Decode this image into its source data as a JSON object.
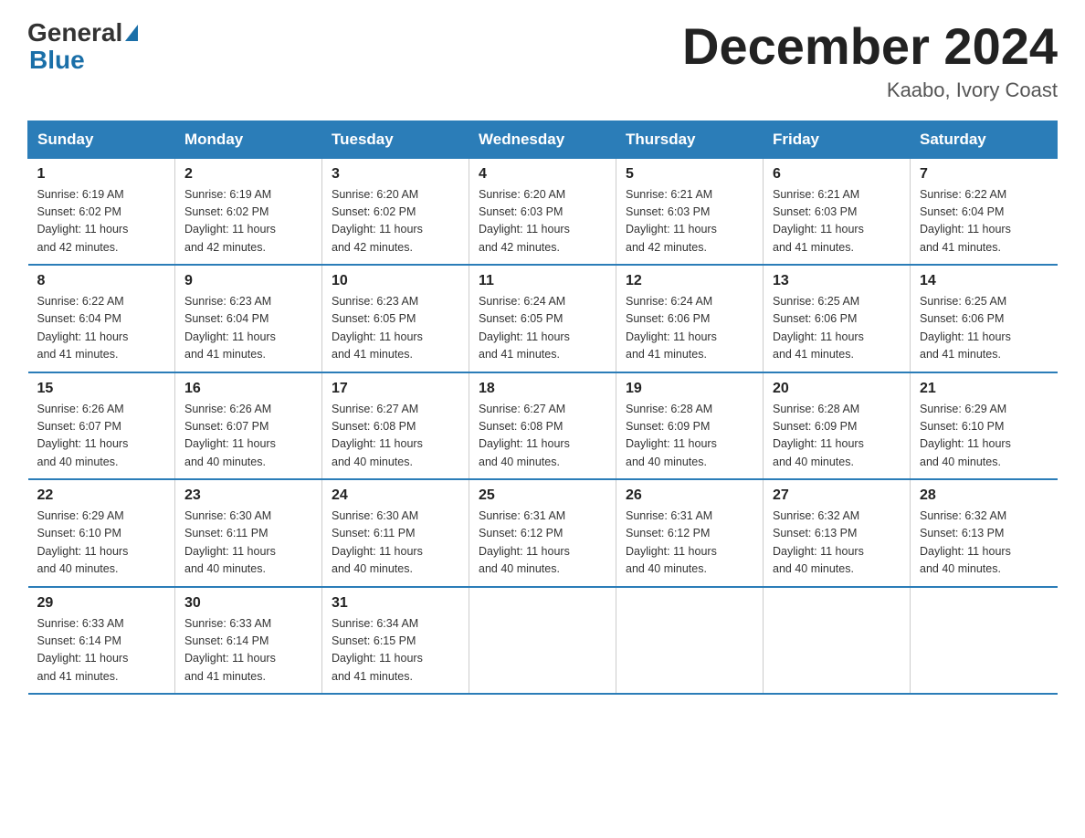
{
  "header": {
    "logo_general": "General",
    "logo_blue": "Blue",
    "month_title": "December 2024",
    "location": "Kaabo, Ivory Coast"
  },
  "days_of_week": [
    "Sunday",
    "Monday",
    "Tuesday",
    "Wednesday",
    "Thursday",
    "Friday",
    "Saturday"
  ],
  "weeks": [
    [
      {
        "day": "1",
        "sunrise": "6:19 AM",
        "sunset": "6:02 PM",
        "daylight": "11 hours and 42 minutes."
      },
      {
        "day": "2",
        "sunrise": "6:19 AM",
        "sunset": "6:02 PM",
        "daylight": "11 hours and 42 minutes."
      },
      {
        "day": "3",
        "sunrise": "6:20 AM",
        "sunset": "6:02 PM",
        "daylight": "11 hours and 42 minutes."
      },
      {
        "day": "4",
        "sunrise": "6:20 AM",
        "sunset": "6:03 PM",
        "daylight": "11 hours and 42 minutes."
      },
      {
        "day": "5",
        "sunrise": "6:21 AM",
        "sunset": "6:03 PM",
        "daylight": "11 hours and 42 minutes."
      },
      {
        "day": "6",
        "sunrise": "6:21 AM",
        "sunset": "6:03 PM",
        "daylight": "11 hours and 41 minutes."
      },
      {
        "day": "7",
        "sunrise": "6:22 AM",
        "sunset": "6:04 PM",
        "daylight": "11 hours and 41 minutes."
      }
    ],
    [
      {
        "day": "8",
        "sunrise": "6:22 AM",
        "sunset": "6:04 PM",
        "daylight": "11 hours and 41 minutes."
      },
      {
        "day": "9",
        "sunrise": "6:23 AM",
        "sunset": "6:04 PM",
        "daylight": "11 hours and 41 minutes."
      },
      {
        "day": "10",
        "sunrise": "6:23 AM",
        "sunset": "6:05 PM",
        "daylight": "11 hours and 41 minutes."
      },
      {
        "day": "11",
        "sunrise": "6:24 AM",
        "sunset": "6:05 PM",
        "daylight": "11 hours and 41 minutes."
      },
      {
        "day": "12",
        "sunrise": "6:24 AM",
        "sunset": "6:06 PM",
        "daylight": "11 hours and 41 minutes."
      },
      {
        "day": "13",
        "sunrise": "6:25 AM",
        "sunset": "6:06 PM",
        "daylight": "11 hours and 41 minutes."
      },
      {
        "day": "14",
        "sunrise": "6:25 AM",
        "sunset": "6:06 PM",
        "daylight": "11 hours and 41 minutes."
      }
    ],
    [
      {
        "day": "15",
        "sunrise": "6:26 AM",
        "sunset": "6:07 PM",
        "daylight": "11 hours and 40 minutes."
      },
      {
        "day": "16",
        "sunrise": "6:26 AM",
        "sunset": "6:07 PM",
        "daylight": "11 hours and 40 minutes."
      },
      {
        "day": "17",
        "sunrise": "6:27 AM",
        "sunset": "6:08 PM",
        "daylight": "11 hours and 40 minutes."
      },
      {
        "day": "18",
        "sunrise": "6:27 AM",
        "sunset": "6:08 PM",
        "daylight": "11 hours and 40 minutes."
      },
      {
        "day": "19",
        "sunrise": "6:28 AM",
        "sunset": "6:09 PM",
        "daylight": "11 hours and 40 minutes."
      },
      {
        "day": "20",
        "sunrise": "6:28 AM",
        "sunset": "6:09 PM",
        "daylight": "11 hours and 40 minutes."
      },
      {
        "day": "21",
        "sunrise": "6:29 AM",
        "sunset": "6:10 PM",
        "daylight": "11 hours and 40 minutes."
      }
    ],
    [
      {
        "day": "22",
        "sunrise": "6:29 AM",
        "sunset": "6:10 PM",
        "daylight": "11 hours and 40 minutes."
      },
      {
        "day": "23",
        "sunrise": "6:30 AM",
        "sunset": "6:11 PM",
        "daylight": "11 hours and 40 minutes."
      },
      {
        "day": "24",
        "sunrise": "6:30 AM",
        "sunset": "6:11 PM",
        "daylight": "11 hours and 40 minutes."
      },
      {
        "day": "25",
        "sunrise": "6:31 AM",
        "sunset": "6:12 PM",
        "daylight": "11 hours and 40 minutes."
      },
      {
        "day": "26",
        "sunrise": "6:31 AM",
        "sunset": "6:12 PM",
        "daylight": "11 hours and 40 minutes."
      },
      {
        "day": "27",
        "sunrise": "6:32 AM",
        "sunset": "6:13 PM",
        "daylight": "11 hours and 40 minutes."
      },
      {
        "day": "28",
        "sunrise": "6:32 AM",
        "sunset": "6:13 PM",
        "daylight": "11 hours and 40 minutes."
      }
    ],
    [
      {
        "day": "29",
        "sunrise": "6:33 AM",
        "sunset": "6:14 PM",
        "daylight": "11 hours and 41 minutes."
      },
      {
        "day": "30",
        "sunrise": "6:33 AM",
        "sunset": "6:14 PM",
        "daylight": "11 hours and 41 minutes."
      },
      {
        "day": "31",
        "sunrise": "6:34 AM",
        "sunset": "6:15 PM",
        "daylight": "11 hours and 41 minutes."
      },
      null,
      null,
      null,
      null
    ]
  ],
  "labels": {
    "sunrise": "Sunrise:",
    "sunset": "Sunset:",
    "daylight": "Daylight:"
  }
}
